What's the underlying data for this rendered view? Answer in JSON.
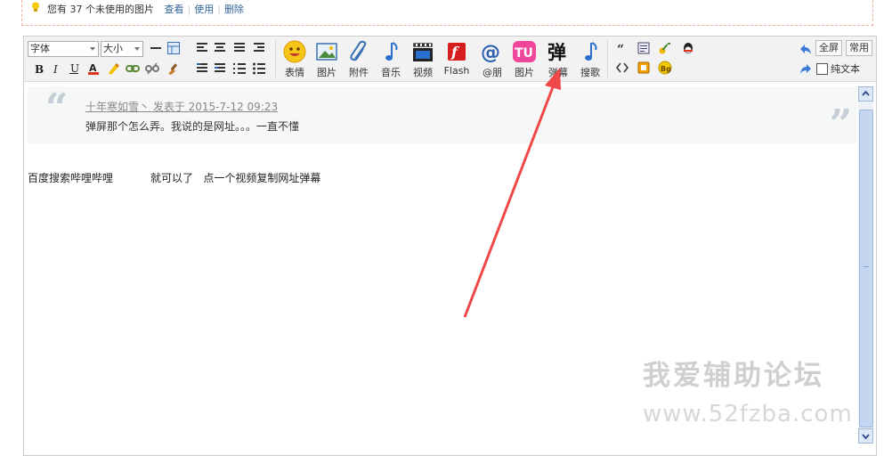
{
  "notice": {
    "text": "您有 37 个未使用的图片",
    "view_link": "查看",
    "use_link": "使用",
    "delete_link": "删除"
  },
  "toolbar": {
    "font_select": "字体",
    "size_select": "大小",
    "buttons": [
      {
        "label": "表情",
        "icon": "smiley-icon"
      },
      {
        "label": "图片",
        "icon": "image-icon"
      },
      {
        "label": "附件",
        "icon": "paperclip-icon"
      },
      {
        "label": "音乐",
        "icon": "music-note-icon"
      },
      {
        "label": "视频",
        "icon": "clapperboard-icon"
      },
      {
        "label": "Flash",
        "icon": "flash-icon"
      },
      {
        "label": "@朋",
        "icon": "at-sign-icon"
      },
      {
        "label": "图片",
        "icon": "tu-image-icon"
      },
      {
        "label": "弹幕",
        "icon": "danmu-icon",
        "glyph": "弹"
      },
      {
        "label": "搜歌",
        "icon": "search-song-icon"
      }
    ],
    "fullscreen_button": "全屏",
    "common_button": "常用",
    "plain_text_label": "纯文本",
    "tu_glyph": "TU",
    "bg_glyph": "Bg",
    "at_glyph": "@"
  },
  "quote": {
    "meta": "十年寒如雪丶 发表于 2015-7-12 09:23",
    "message": "弹屏那个怎么弄。我说的是网址。。。一直不懂",
    "open_mark": "“",
    "close_mark": "”"
  },
  "body": {
    "text": "百度搜索哔哩哔哩           就可以了   点一个视频复制网址弹幕"
  },
  "watermark": {
    "cn": "我爱辅助论坛",
    "url": "www.52fzba.com"
  },
  "colors": {
    "arrow": "#f04848",
    "link": "#336699",
    "quote_mark": "#c3ced6"
  }
}
